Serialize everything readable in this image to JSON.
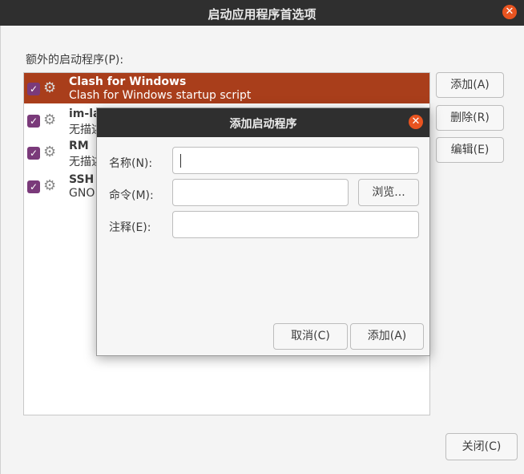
{
  "window": {
    "title": "启动应用程序首选项"
  },
  "main": {
    "section_label": "额外的启动程序(P):",
    "items": [
      {
        "name": "Clash for Windows",
        "description": "Clash for Windows startup script",
        "checked": true,
        "selected": true
      },
      {
        "name": "im-la",
        "description": "无描述",
        "checked": true,
        "selected": false
      },
      {
        "name": "RM",
        "description": "无描述",
        "checked": true,
        "selected": false
      },
      {
        "name": "SSH",
        "description": "GNO",
        "checked": true,
        "selected": false
      }
    ],
    "buttons": {
      "add": "添加(A)",
      "remove": "删除(R)",
      "edit": "编辑(E)",
      "close": "关闭(C)"
    }
  },
  "dialog": {
    "title": "添加启动程序",
    "name_label": "名称(N):",
    "name_value": "",
    "command_label": "命令(M):",
    "command_value": "",
    "browse_label": "浏览...",
    "comment_label": "注释(E):",
    "comment_value": "",
    "cancel_label": "取消(C)",
    "add_label": "添加(A)"
  },
  "colors": {
    "selection": "#a93e1b",
    "close_button": "#e95420",
    "checkbox": "#7a3a7a",
    "titlebar": "#2f2f2f"
  },
  "icons": {
    "item_icon": "gears-icon",
    "close": "close-icon",
    "check": "checkmark-icon"
  }
}
